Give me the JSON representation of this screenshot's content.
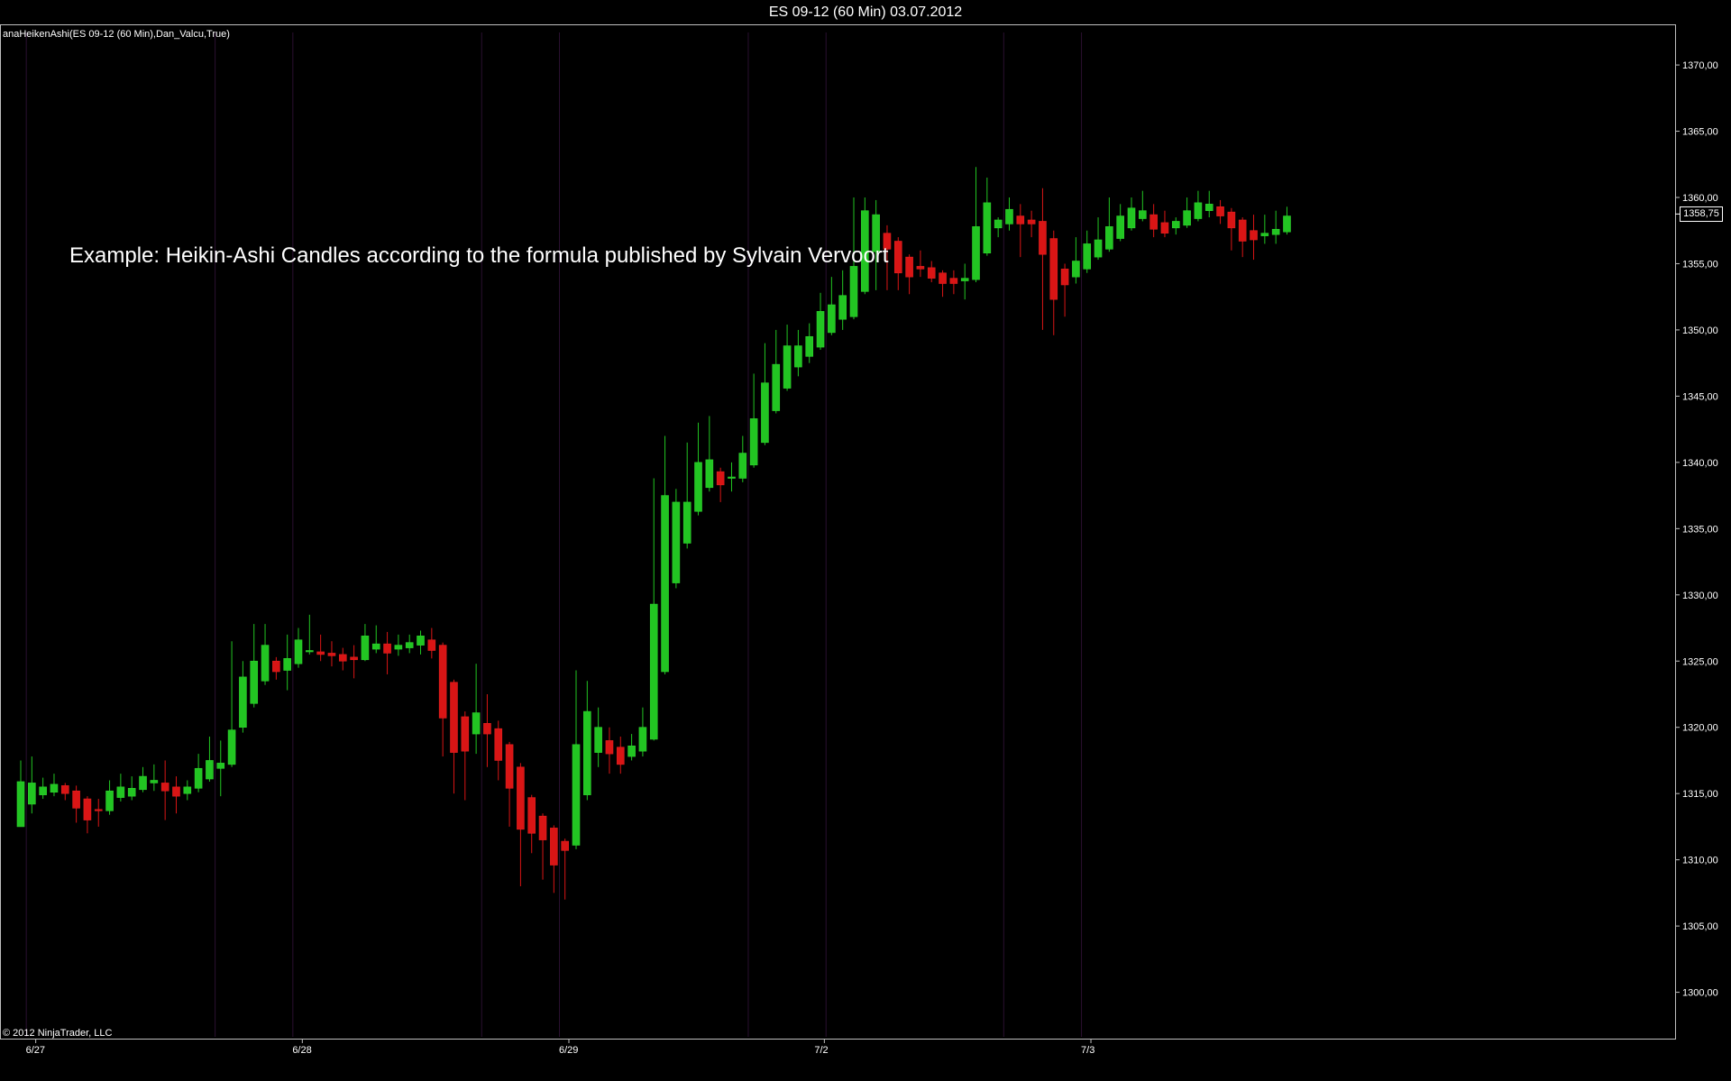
{
  "window": {
    "title": "ES 09-12 (60 Min)  03.07.2012"
  },
  "indicator_label": "anaHeikenAshi(ES 09-12 (60 Min),Dan_Valcu,True)",
  "copyright": "© 2012 NinjaTrader, LLC",
  "annotation": "Example: Heikin-Ashi Candles according to the formula published by Sylvain Vervoort",
  "last_price_label": "1358,75",
  "colors": {
    "up": "#22c522",
    "down": "#d91515",
    "up_wick": "#22c522",
    "down_wick": "#d91515",
    "session_line": "#2a1030",
    "axis": "#bfbfbf"
  },
  "chart_data": {
    "type": "candlestick",
    "title": "ES 09-12 (60 Min)  03.07.2012",
    "ylim": [
      1296.5,
      1373
    ],
    "yticks": [
      1300,
      1305,
      1310,
      1315,
      1320,
      1325,
      1330,
      1335,
      1340,
      1345,
      1350,
      1355,
      1360,
      1365,
      1370
    ],
    "ytick_labels": [
      "1300,00",
      "1305,00",
      "1310,00",
      "1315,00",
      "1320,00",
      "1325,00",
      "1330,00",
      "1335,00",
      "1340,00",
      "1345,00",
      "1350,00",
      "1355,00",
      "1360,00",
      "1365,00",
      "1370,00"
    ],
    "xticks": [
      {
        "label": "6/27",
        "index": 2
      },
      {
        "label": "6/28",
        "index": 26
      },
      {
        "label": "6/29",
        "index": 50
      },
      {
        "label": "7/2",
        "index": 73
      },
      {
        "label": "7/3",
        "index": 97
      }
    ],
    "session_dividers": [
      0.5,
      17.5,
      24.5,
      41.5,
      48.5,
      65.5,
      72.5,
      88.5,
      95.5
    ],
    "last_price": 1358.75,
    "candles": [
      {
        "o": 1312.5,
        "h": 1317.5,
        "l": 1312.5,
        "c": 1315.9
      },
      {
        "o": 1314.2,
        "h": 1317.8,
        "l": 1313.5,
        "c": 1315.8
      },
      {
        "o": 1314.9,
        "h": 1316.2,
        "l": 1314.6,
        "c": 1315.5
      },
      {
        "o": 1315.1,
        "h": 1316.5,
        "l": 1314.8,
        "c": 1315.7
      },
      {
        "o": 1315.6,
        "h": 1315.8,
        "l": 1314.5,
        "c": 1315.0
      },
      {
        "o": 1315.2,
        "h": 1315.6,
        "l": 1312.8,
        "c": 1313.9
      },
      {
        "o": 1314.6,
        "h": 1314.8,
        "l": 1312.0,
        "c": 1313.0
      },
      {
        "o": 1313.8,
        "h": 1314.6,
        "l": 1312.5,
        "c": 1313.7
      },
      {
        "o": 1313.7,
        "h": 1316.0,
        "l": 1313.4,
        "c": 1315.2
      },
      {
        "o": 1314.7,
        "h": 1316.5,
        "l": 1314.4,
        "c": 1315.5
      },
      {
        "o": 1314.8,
        "h": 1316.3,
        "l": 1314.5,
        "c": 1315.4
      },
      {
        "o": 1315.3,
        "h": 1317.0,
        "l": 1315.1,
        "c": 1316.3
      },
      {
        "o": 1315.8,
        "h": 1317.2,
        "l": 1315.2,
        "c": 1316.0
      },
      {
        "o": 1315.8,
        "h": 1317.5,
        "l": 1313.0,
        "c": 1315.2
      },
      {
        "o": 1315.5,
        "h": 1316.3,
        "l": 1313.5,
        "c": 1314.8
      },
      {
        "o": 1315.0,
        "h": 1316.0,
        "l": 1314.5,
        "c": 1315.5
      },
      {
        "o": 1315.4,
        "h": 1318.0,
        "l": 1315.1,
        "c": 1316.9
      },
      {
        "o": 1316.1,
        "h": 1319.3,
        "l": 1315.9,
        "c": 1317.5
      },
      {
        "o": 1316.9,
        "h": 1319.0,
        "l": 1314.8,
        "c": 1317.3
      },
      {
        "o": 1317.2,
        "h": 1326.5,
        "l": 1317.0,
        "c": 1319.8
      },
      {
        "o": 1320.0,
        "h": 1325.0,
        "l": 1319.6,
        "c": 1323.8
      },
      {
        "o": 1321.8,
        "h": 1327.8,
        "l": 1321.5,
        "c": 1325.0
      },
      {
        "o": 1323.5,
        "h": 1327.8,
        "l": 1323.2,
        "c": 1326.2
      },
      {
        "o": 1325.0,
        "h": 1325.3,
        "l": 1323.6,
        "c": 1324.2
      },
      {
        "o": 1324.3,
        "h": 1327.0,
        "l": 1322.8,
        "c": 1325.2
      },
      {
        "o": 1324.8,
        "h": 1327.5,
        "l": 1324.5,
        "c": 1326.6
      },
      {
        "o": 1325.7,
        "h": 1328.5,
        "l": 1325.5,
        "c": 1325.8
      },
      {
        "o": 1325.7,
        "h": 1327.0,
        "l": 1325.0,
        "c": 1325.5
      },
      {
        "o": 1325.6,
        "h": 1326.5,
        "l": 1324.6,
        "c": 1325.4
      },
      {
        "o": 1325.5,
        "h": 1326.0,
        "l": 1324.3,
        "c": 1325.0
      },
      {
        "o": 1325.3,
        "h": 1326.2,
        "l": 1323.7,
        "c": 1325.1
      },
      {
        "o": 1325.1,
        "h": 1327.8,
        "l": 1325.0,
        "c": 1326.9
      },
      {
        "o": 1325.9,
        "h": 1327.7,
        "l": 1325.6,
        "c": 1326.3
      },
      {
        "o": 1326.3,
        "h": 1327.2,
        "l": 1324.0,
        "c": 1325.6
      },
      {
        "o": 1325.9,
        "h": 1327.0,
        "l": 1325.4,
        "c": 1326.2
      },
      {
        "o": 1326.0,
        "h": 1327.0,
        "l": 1325.6,
        "c": 1326.4
      },
      {
        "o": 1326.2,
        "h": 1327.3,
        "l": 1325.5,
        "c": 1326.9
      },
      {
        "o": 1326.6,
        "h": 1327.5,
        "l": 1325.2,
        "c": 1325.8
      },
      {
        "o": 1326.2,
        "h": 1326.4,
        "l": 1317.8,
        "c": 1320.7
      },
      {
        "o": 1323.4,
        "h": 1323.6,
        "l": 1315.0,
        "c": 1318.1
      },
      {
        "o": 1320.8,
        "h": 1321.2,
        "l": 1314.5,
        "c": 1318.2
      },
      {
        "o": 1319.5,
        "h": 1324.8,
        "l": 1318.0,
        "c": 1321.1
      },
      {
        "o": 1320.3,
        "h": 1322.5,
        "l": 1317.0,
        "c": 1319.5
      },
      {
        "o": 1319.9,
        "h": 1320.5,
        "l": 1316.0,
        "c": 1317.5
      },
      {
        "o": 1318.7,
        "h": 1318.9,
        "l": 1312.5,
        "c": 1315.4
      },
      {
        "o": 1317.0,
        "h": 1317.3,
        "l": 1308.0,
        "c": 1312.3
      },
      {
        "o": 1314.7,
        "h": 1314.9,
        "l": 1310.5,
        "c": 1312.0
      },
      {
        "o": 1313.3,
        "h": 1313.5,
        "l": 1308.5,
        "c": 1311.5
      },
      {
        "o": 1312.4,
        "h": 1312.6,
        "l": 1307.5,
        "c": 1309.6
      },
      {
        "o": 1311.4,
        "h": 1311.6,
        "l": 1307.0,
        "c": 1310.7
      },
      {
        "o": 1311.1,
        "h": 1324.3,
        "l": 1310.8,
        "c": 1318.7
      },
      {
        "o": 1314.9,
        "h": 1323.5,
        "l": 1314.5,
        "c": 1321.2
      },
      {
        "o": 1318.1,
        "h": 1321.5,
        "l": 1317.0,
        "c": 1320.0
      },
      {
        "o": 1319.0,
        "h": 1320.0,
        "l": 1316.5,
        "c": 1318.0
      },
      {
        "o": 1318.5,
        "h": 1319.3,
        "l": 1316.5,
        "c": 1317.2
      },
      {
        "o": 1317.8,
        "h": 1319.5,
        "l": 1317.5,
        "c": 1318.6
      },
      {
        "o": 1318.2,
        "h": 1321.5,
        "l": 1317.8,
        "c": 1320.0
      },
      {
        "o": 1319.1,
        "h": 1338.8,
        "l": 1319.0,
        "c": 1329.3
      },
      {
        "o": 1324.2,
        "h": 1342.0,
        "l": 1324.0,
        "c": 1337.5
      },
      {
        "o": 1330.9,
        "h": 1338.0,
        "l": 1330.5,
        "c": 1337.0
      },
      {
        "o": 1333.9,
        "h": 1341.5,
        "l": 1333.5,
        "c": 1337.0
      },
      {
        "o": 1336.3,
        "h": 1343.0,
        "l": 1336.0,
        "c": 1340.0
      },
      {
        "o": 1338.1,
        "h": 1343.5,
        "l": 1337.8,
        "c": 1340.2
      },
      {
        "o": 1339.3,
        "h": 1339.6,
        "l": 1337.0,
        "c": 1338.3
      },
      {
        "o": 1338.8,
        "h": 1340.0,
        "l": 1337.8,
        "c": 1338.9
      },
      {
        "o": 1338.8,
        "h": 1342.0,
        "l": 1338.5,
        "c": 1340.7
      },
      {
        "o": 1339.8,
        "h": 1346.7,
        "l": 1339.6,
        "c": 1343.3
      },
      {
        "o": 1341.5,
        "h": 1349.0,
        "l": 1341.3,
        "c": 1346.0
      },
      {
        "o": 1343.9,
        "h": 1350.0,
        "l": 1343.7,
        "c": 1347.4
      },
      {
        "o": 1345.6,
        "h": 1350.4,
        "l": 1345.4,
        "c": 1348.8
      },
      {
        "o": 1347.2,
        "h": 1350.0,
        "l": 1346.5,
        "c": 1348.8
      },
      {
        "o": 1348.0,
        "h": 1350.5,
        "l": 1347.5,
        "c": 1349.5
      },
      {
        "o": 1348.7,
        "h": 1352.8,
        "l": 1348.5,
        "c": 1351.4
      },
      {
        "o": 1349.8,
        "h": 1354.0,
        "l": 1349.6,
        "c": 1351.9
      },
      {
        "o": 1350.8,
        "h": 1354.5,
        "l": 1350.0,
        "c": 1352.6
      },
      {
        "o": 1351.0,
        "h": 1360.0,
        "l": 1350.8,
        "c": 1354.8
      },
      {
        "o": 1352.9,
        "h": 1360.0,
        "l": 1352.7,
        "c": 1359.0
      },
      {
        "o": 1355.9,
        "h": 1359.8,
        "l": 1353.0,
        "c": 1358.7
      },
      {
        "o": 1357.3,
        "h": 1357.9,
        "l": 1353.0,
        "c": 1356.1
      },
      {
        "o": 1356.7,
        "h": 1357.0,
        "l": 1353.0,
        "c": 1354.3
      },
      {
        "o": 1355.5,
        "h": 1355.7,
        "l": 1352.7,
        "c": 1354.0
      },
      {
        "o": 1354.8,
        "h": 1356.0,
        "l": 1354.0,
        "c": 1354.6
      },
      {
        "o": 1354.7,
        "h": 1355.2,
        "l": 1353.6,
        "c": 1353.9
      },
      {
        "o": 1354.3,
        "h": 1354.5,
        "l": 1352.5,
        "c": 1353.5
      },
      {
        "o": 1353.9,
        "h": 1354.5,
        "l": 1352.7,
        "c": 1353.5
      },
      {
        "o": 1353.7,
        "h": 1355.0,
        "l": 1352.3,
        "c": 1353.9
      },
      {
        "o": 1353.8,
        "h": 1362.3,
        "l": 1353.6,
        "c": 1357.8
      },
      {
        "o": 1355.8,
        "h": 1361.5,
        "l": 1355.6,
        "c": 1359.6
      },
      {
        "o": 1357.7,
        "h": 1358.5,
        "l": 1357.0,
        "c": 1358.3
      },
      {
        "o": 1358.0,
        "h": 1360.0,
        "l": 1357.5,
        "c": 1359.1
      },
      {
        "o": 1358.6,
        "h": 1359.5,
        "l": 1355.5,
        "c": 1358.0
      },
      {
        "o": 1358.3,
        "h": 1359.0,
        "l": 1357.0,
        "c": 1358.0
      },
      {
        "o": 1358.2,
        "h": 1360.7,
        "l": 1350.0,
        "c": 1355.7
      },
      {
        "o": 1356.9,
        "h": 1357.5,
        "l": 1349.6,
        "c": 1352.3
      },
      {
        "o": 1354.6,
        "h": 1355.0,
        "l": 1351.0,
        "c": 1353.4
      },
      {
        "o": 1354.0,
        "h": 1357.0,
        "l": 1353.5,
        "c": 1355.2
      },
      {
        "o": 1354.6,
        "h": 1357.5,
        "l": 1354.3,
        "c": 1356.5
      },
      {
        "o": 1355.5,
        "h": 1358.5,
        "l": 1355.3,
        "c": 1356.8
      },
      {
        "o": 1356.1,
        "h": 1360.0,
        "l": 1355.9,
        "c": 1357.8
      },
      {
        "o": 1356.9,
        "h": 1359.5,
        "l": 1356.7,
        "c": 1358.6
      },
      {
        "o": 1357.7,
        "h": 1360.0,
        "l": 1357.5,
        "c": 1359.2
      },
      {
        "o": 1358.4,
        "h": 1360.5,
        "l": 1358.2,
        "c": 1359.0
      },
      {
        "o": 1358.7,
        "h": 1359.5,
        "l": 1357.0,
        "c": 1357.6
      },
      {
        "o": 1358.1,
        "h": 1359.0,
        "l": 1357.0,
        "c": 1357.3
      },
      {
        "o": 1357.7,
        "h": 1358.5,
        "l": 1357.2,
        "c": 1358.2
      },
      {
        "o": 1357.9,
        "h": 1360.0,
        "l": 1357.7,
        "c": 1359.0
      },
      {
        "o": 1358.4,
        "h": 1360.5,
        "l": 1358.2,
        "c": 1359.6
      },
      {
        "o": 1359.0,
        "h": 1360.5,
        "l": 1358.5,
        "c": 1359.5
      },
      {
        "o": 1359.3,
        "h": 1359.8,
        "l": 1358.0,
        "c": 1358.6
      },
      {
        "o": 1358.9,
        "h": 1359.2,
        "l": 1356.0,
        "c": 1357.7
      },
      {
        "o": 1358.3,
        "h": 1358.5,
        "l": 1355.5,
        "c": 1356.7
      },
      {
        "o": 1357.5,
        "h": 1358.7,
        "l": 1355.3,
        "c": 1356.8
      },
      {
        "o": 1357.1,
        "h": 1358.7,
        "l": 1356.5,
        "c": 1357.3
      },
      {
        "o": 1357.2,
        "h": 1359.0,
        "l": 1356.5,
        "c": 1357.6
      },
      {
        "o": 1357.4,
        "h": 1359.3,
        "l": 1357.2,
        "c": 1358.6
      }
    ]
  }
}
